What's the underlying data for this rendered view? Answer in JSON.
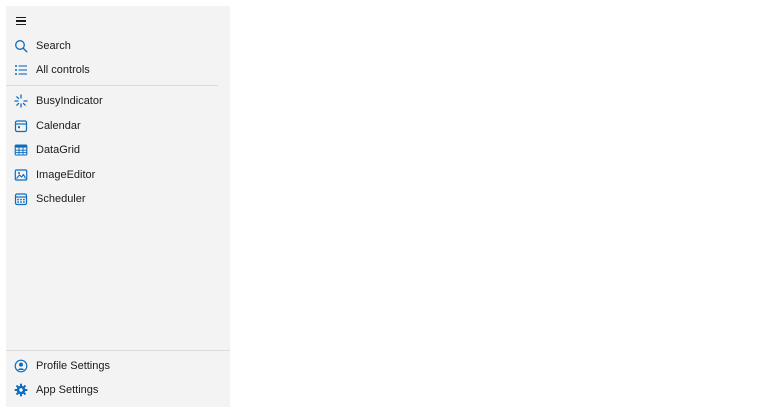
{
  "colors": {
    "accent": "#0f6cbd",
    "sidebar_bg": "#f3f3f3",
    "divider": "#dcdcdc",
    "text": "#1b1b1b"
  },
  "hamburger": {
    "icon": "hamburger-icon"
  },
  "nav": {
    "top": [
      {
        "label": "Search",
        "icon": "search-icon"
      },
      {
        "label": "All controls",
        "icon": "list-icon"
      }
    ],
    "controls": [
      {
        "label": "BusyIndicator",
        "icon": "busy-indicator-icon"
      },
      {
        "label": "Calendar",
        "icon": "calendar-icon"
      },
      {
        "label": "DataGrid",
        "icon": "datagrid-icon"
      },
      {
        "label": "ImageEditor",
        "icon": "image-editor-icon"
      },
      {
        "label": "Scheduler",
        "icon": "scheduler-icon"
      }
    ],
    "footer": [
      {
        "label": "Profile Settings",
        "icon": "profile-icon"
      },
      {
        "label": "App Settings",
        "icon": "gear-icon"
      }
    ]
  }
}
